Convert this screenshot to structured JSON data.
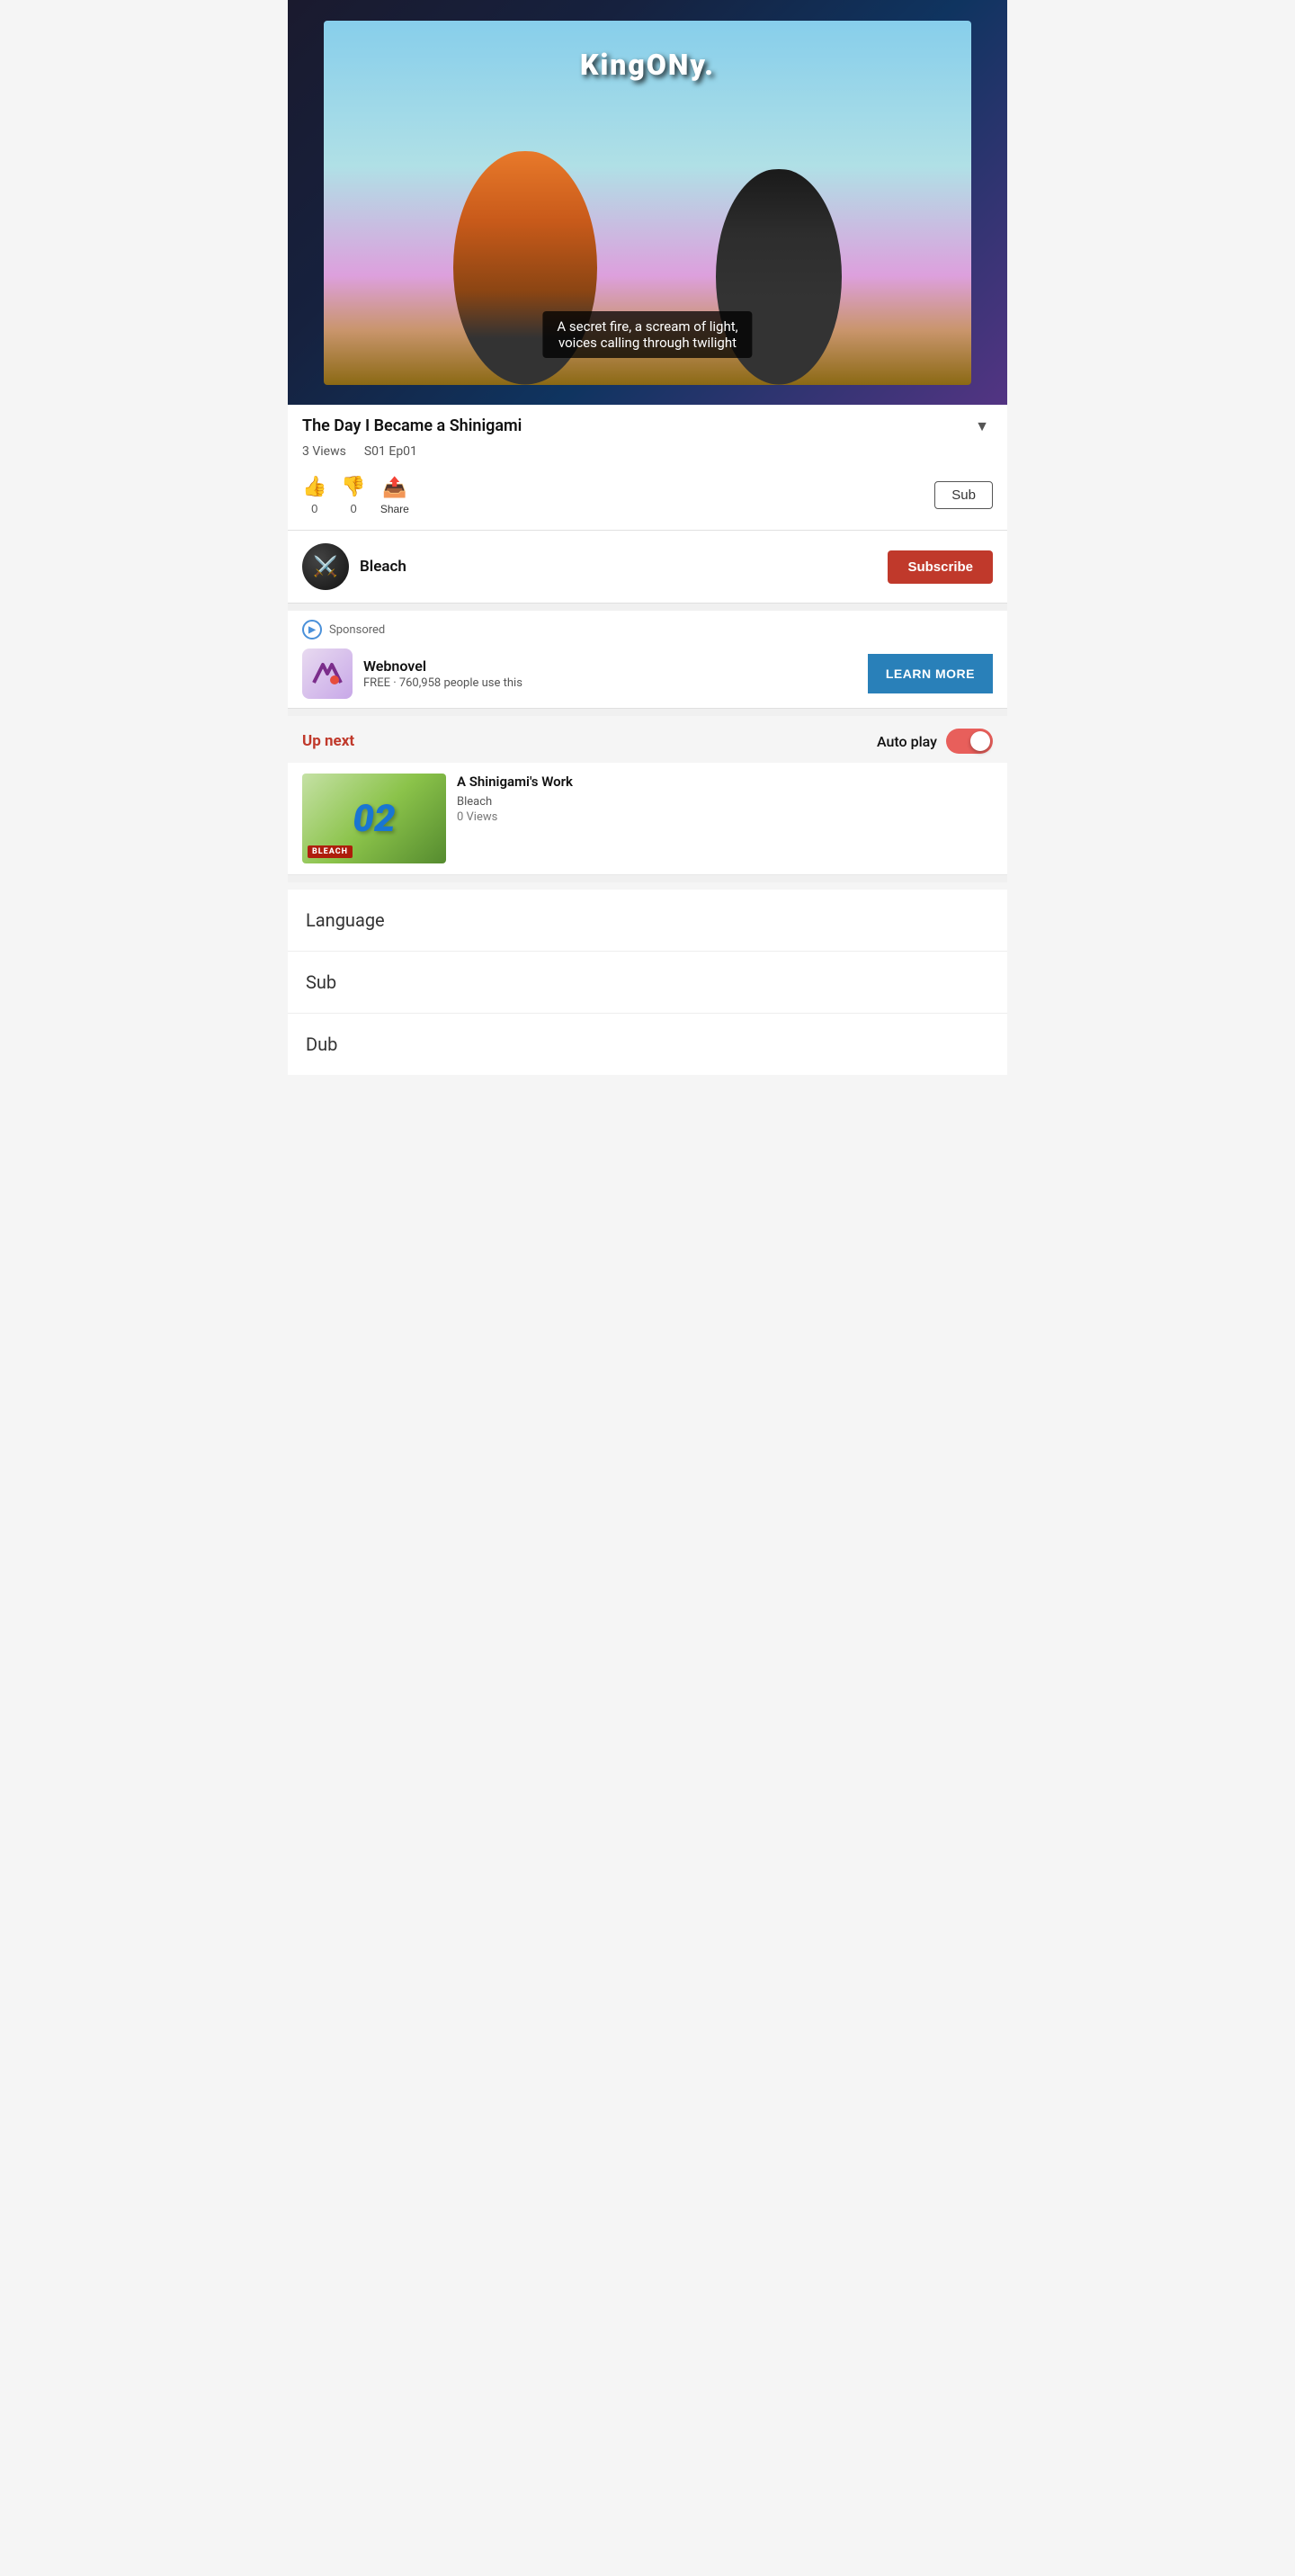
{
  "video": {
    "subtitle_line1": "A secret fire, a scream of light,",
    "subtitle_line2": "voices calling through twilight",
    "title": "The Day I Became a Shinigami",
    "views": "3 Views",
    "episode": "S01 Ep01",
    "likes": "0",
    "dislikes": "0",
    "share_label": "Share",
    "sub_lang_label": "Sub"
  },
  "channel": {
    "name": "Bleach",
    "subscribe_label": "Subscribe"
  },
  "sponsored": {
    "label": "Sponsored",
    "ad_title": "Webnovel",
    "ad_subtitle": "FREE · 760,958 people use this",
    "learn_more_label": "LEARN MORE"
  },
  "up_next": {
    "label": "Up next",
    "autoplay_label": "Auto play",
    "next_title": "A Shinigami's Work",
    "next_channel": "Bleach",
    "next_views": "0 Views",
    "thumb_number": "02",
    "thumb_series": "BLEACH"
  },
  "bottom_menu": {
    "language_label": "Language",
    "sub_label": "Sub",
    "dub_label": "Dub"
  },
  "icons": {
    "chevron_down": "▼",
    "thumbs_up": "👍",
    "thumbs_down": "👎",
    "share": "📤",
    "play_triangle": "▶"
  }
}
